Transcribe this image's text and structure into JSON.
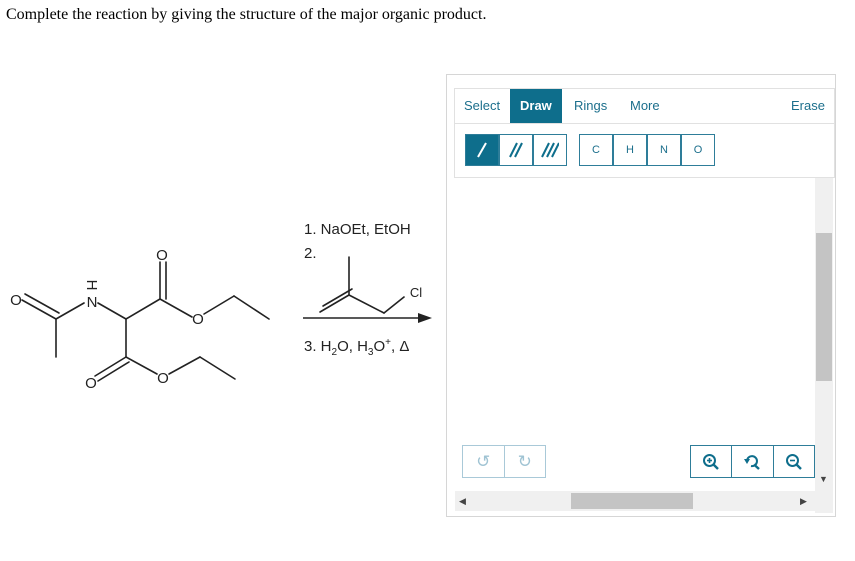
{
  "question": "Complete the reaction by giving the structure of the major organic product.",
  "reactant_labels": {
    "o_ketone": "O",
    "n_atom": "N",
    "h_atom": "H",
    "o_ester1_carbonyl": "O",
    "o_ester1_ether": "O",
    "o_ester2_carbonyl": "O",
    "o_ester2_ether": "O"
  },
  "conditions": {
    "step1": "1. NaOEt, EtOH",
    "step2": "2.",
    "step2_reagent_cl": "Cl",
    "step3_prefix": "3. H",
    "step3_sub1": "2",
    "step3_mid1": "O, H",
    "step3_sub2": "3",
    "step3_mid2": "O",
    "step3_sup": "+",
    "step3_suffix": ", Δ"
  },
  "editor": {
    "tabs": {
      "select": "Select",
      "draw": "Draw",
      "rings": "Rings",
      "more": "More",
      "erase": "Erase"
    },
    "atoms": [
      "C",
      "H",
      "N",
      "O"
    ],
    "icons": {
      "single_bond": "single-bond-icon",
      "double_bond": "double-bond-icon",
      "triple_bond": "triple-bond-icon",
      "undo": "undo-icon",
      "redo": "redo-icon",
      "zoom_in": "zoom-in-icon",
      "zoom_reset": "zoom-reset-icon",
      "zoom_out": "zoom-out-icon"
    },
    "accent_color": "#0e6e8c",
    "active_tab": "Draw",
    "active_bond": "single"
  }
}
